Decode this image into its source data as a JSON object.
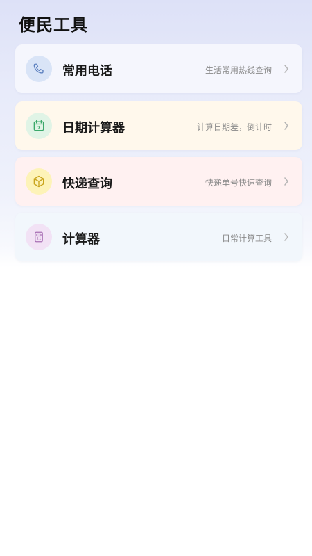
{
  "page": {
    "title": "便民工具"
  },
  "tools": [
    {
      "title": "常用电话",
      "desc": "生活常用热线查询",
      "icon": "phone-icon",
      "bg": "#f5f6fd",
      "icon_bg": "#d9e4f7",
      "icon_color": "#5b7fbf"
    },
    {
      "title": "日期计算器",
      "desc": "计算日期差，倒计时",
      "icon": "calendar-icon",
      "bg": "#fff8ec",
      "icon_bg": "#e0f4e6",
      "icon_color": "#3aa86a"
    },
    {
      "title": "快递查询",
      "desc": "快递单号快速查询",
      "icon": "package-icon",
      "bg": "#fff1f1",
      "icon_bg": "#fdf3b8",
      "icon_color": "#c9a41c"
    },
    {
      "title": "计算器",
      "desc": "日常计算工具",
      "icon": "calculator-icon",
      "bg": "#f2f7fc",
      "icon_bg": "#f2e2f5",
      "icon_color": "#a86fb4"
    }
  ],
  "calendar_icon_day": "7",
  "chevron_icon": "chevron-right-icon"
}
